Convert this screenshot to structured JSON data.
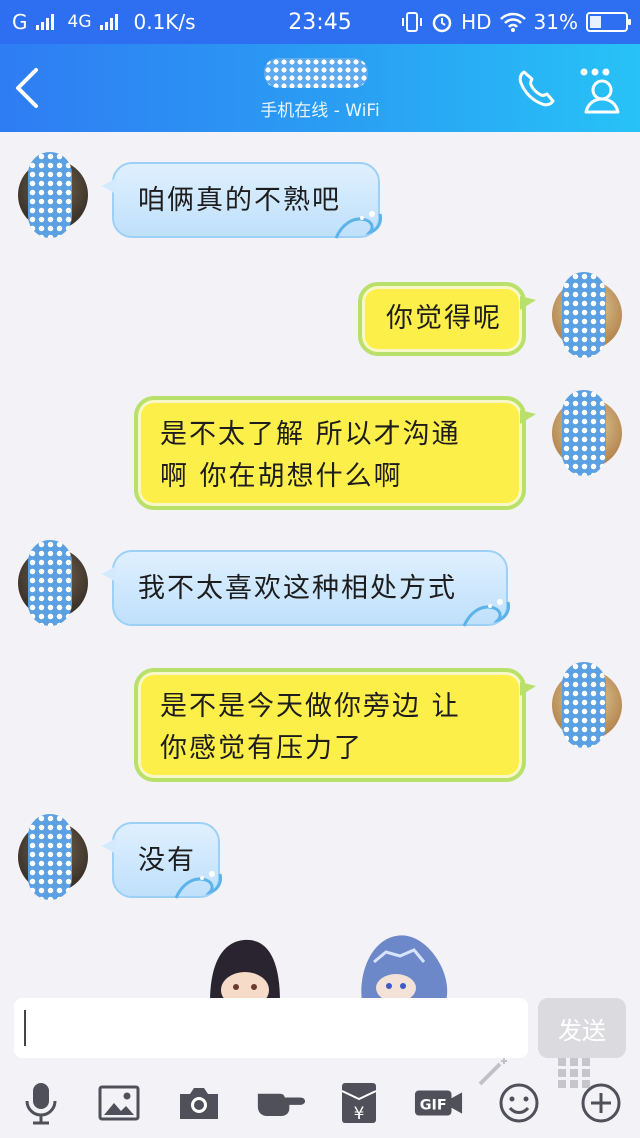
{
  "status_bar": {
    "carrier_label": "G",
    "network_label": "4G",
    "speed": "0.1K/s",
    "time": "23:45",
    "hd_label": "HD",
    "battery_percent": "31%",
    "battery_level": 0.31,
    "icons": [
      "signal-icon",
      "vibrate-icon",
      "alarm-icon",
      "wifi-icon",
      "battery-icon"
    ]
  },
  "header": {
    "presence": "手机在线 - WiFi",
    "icons": [
      "back-arrow-icon",
      "phone-icon",
      "profile-icon"
    ],
    "accent_color": "#2a9ff3"
  },
  "messages": [
    {
      "side": "left",
      "style": "blue",
      "text": "咱俩真的不熟吧"
    },
    {
      "side": "right",
      "style": "yellow",
      "text": "你觉得呢"
    },
    {
      "side": "right",
      "style": "yellow",
      "text": "是不太了解 所以才沟通\n啊 你在胡想什么啊"
    },
    {
      "side": "left",
      "style": "blue",
      "text": "我不太喜欢这种相处方式"
    },
    {
      "side": "right",
      "style": "yellow",
      "text": "是不是今天做你旁边 让\n你感觉有压力了"
    },
    {
      "side": "left",
      "style": "blue",
      "text": "没有"
    }
  ],
  "composer": {
    "value": "",
    "send_label": "发送"
  },
  "toolbar": {
    "items": [
      "microphone-icon",
      "image-icon",
      "camera-icon",
      "hand-icon",
      "red-packet-icon",
      "gif-icon",
      "emoji-icon",
      "plus-icon"
    ],
    "gif_label": "GIF",
    "red_packet_label": "¥"
  }
}
